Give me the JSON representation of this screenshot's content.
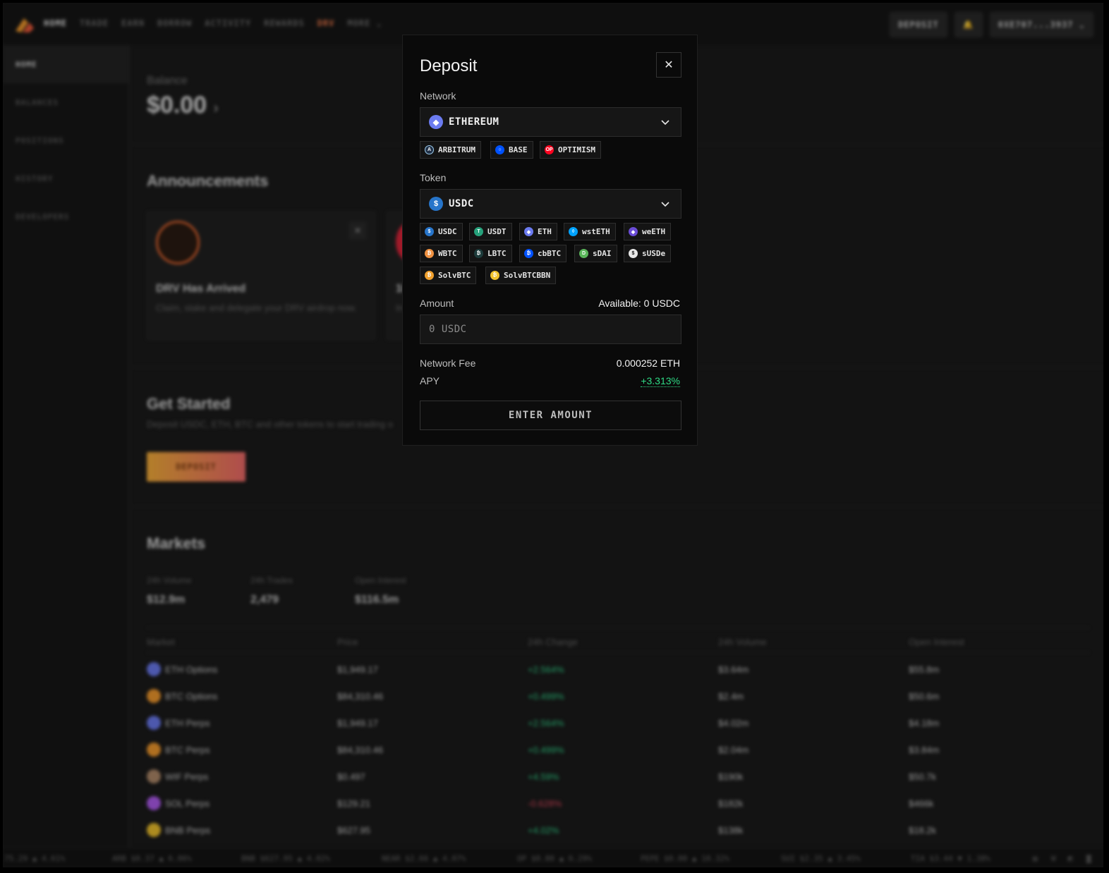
{
  "nav": {
    "items": [
      "HOME",
      "TRADE",
      "EARN",
      "BORROW",
      "ACTIVITY",
      "REWARDS",
      "DRV",
      "MORE"
    ],
    "deposit_label": "DEPOSIT",
    "account": "0XE707...3937"
  },
  "sidebar": {
    "items": [
      "HOME",
      "BALANCES",
      "POSITIONS",
      "HISTORY",
      "DEVELOPERS"
    ]
  },
  "home": {
    "balance_label": "Balance",
    "balance_value": "$0.00",
    "announcements_title": "Announcements",
    "card1_title": "DRV Has Arrived",
    "card1_desc": "Claim, stake and delegate your DRV airdrop now.",
    "card2_title": "10",
    "card2_desc": "In",
    "get_started_title": "Get Started",
    "get_started_desc": "Deposit USDC, ETH, BTC and other tokens to start trading o",
    "get_started_button": "DEPOSIT",
    "markets_title": "Markets",
    "stats": [
      {
        "label": "24h Volume",
        "value": "$12.9m"
      },
      {
        "label": "24h Trades",
        "value": "2,479"
      },
      {
        "label": "Open Interest",
        "value": "$116.5m"
      }
    ],
    "columns": [
      "Market",
      "Price",
      "24h Change",
      "24h Volume",
      "Open Interest"
    ],
    "rows": [
      {
        "name": "ETH Options",
        "price": "$1,949.17",
        "change": "+2.564%",
        "volume": "$3.64m",
        "oi": "$55.8m",
        "color": "#6b7bf0"
      },
      {
        "name": "BTC Options",
        "price": "$84,310.46",
        "change": "+0.499%",
        "volume": "$2.4m",
        "oi": "$50.6m",
        "color": "#f39a2d"
      },
      {
        "name": "ETH Perps",
        "price": "$1,949.17",
        "change": "+2.564%",
        "volume": "$4.02m",
        "oi": "$4.18m",
        "color": "#6b7bf0"
      },
      {
        "name": "BTC Perps",
        "price": "$84,310.46",
        "change": "+0.499%",
        "volume": "$2.04m",
        "oi": "$3.84m",
        "color": "#f39a2d"
      },
      {
        "name": "WIF Perps",
        "price": "$0.497",
        "change": "+4.59%",
        "volume": "$190k",
        "oi": "$50.7k",
        "color": "#b08a6a"
      },
      {
        "name": "SOL Perps",
        "price": "$129.21",
        "change": "-0.628%",
        "volume": "$182k",
        "oi": "$466k",
        "color": "#b05cf0"
      },
      {
        "name": "BNB Perps",
        "price": "$627.95",
        "change": "+4.02%",
        "volume": "$138k",
        "oi": "$18.2k",
        "color": "#f0c22d"
      }
    ],
    "ticker": [
      "75.29 ▲ 4.61%",
      "ARB $0.37 ▲ 6.06%",
      "BNB $627.95 ▲ 4.02%",
      "NEAR $2.66 ▲ 4.07%",
      "OP $0.80 ▲ 6.29%",
      "PEPE $0.00 ▲ 10.32%",
      "SUI $2.35 ▲ 3.45%",
      "TIA $3.44 ▼ 1.38%"
    ]
  },
  "modal": {
    "title": "Deposit",
    "network_label": "Network",
    "network_selected": "ETHEREUM",
    "networks": [
      "ARBITRUM",
      "BASE",
      "OPTIMISM"
    ],
    "token_label": "Token",
    "token_selected": "USDC",
    "tokens": [
      "USDC",
      "USDT",
      "ETH",
      "wstETH",
      "weETH",
      "WBTC",
      "LBTC",
      "cbBTC",
      "sDAI",
      "sUSDe",
      "SolvBTC",
      "SolvBTCBBN"
    ],
    "amount_label": "Amount",
    "available": "Available: 0 USDC",
    "amount_placeholder": "0 USDC",
    "fee_label": "Network Fee",
    "fee_value": "0.000252 ETH",
    "apy_label": "APY",
    "apy_value": "+3.313%",
    "submit_label": "ENTER AMOUNT"
  },
  "colors": {
    "accent_orange": "#ef7a4a",
    "positive": "#2fdc86",
    "negative": "#e0485e"
  }
}
